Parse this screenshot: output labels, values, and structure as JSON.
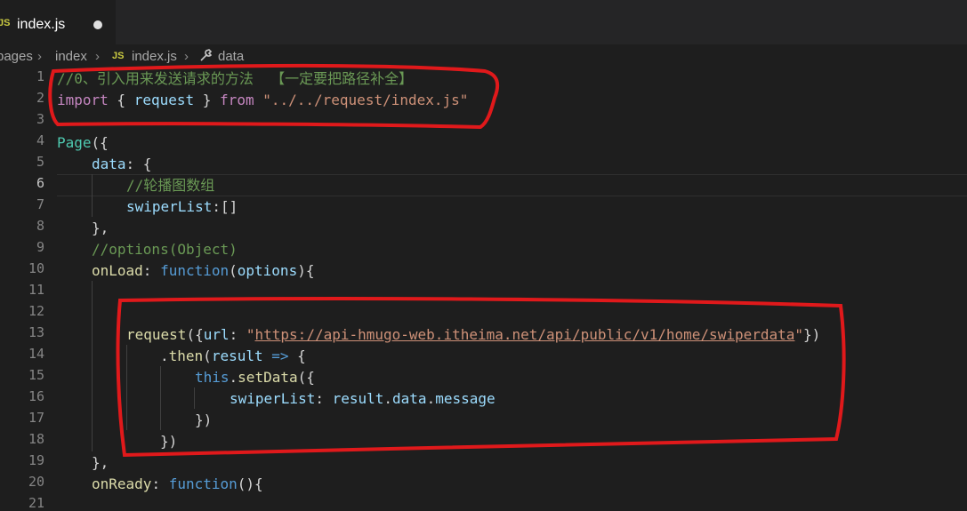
{
  "tab": {
    "file_icon": "JS",
    "filename": "index.js"
  },
  "breadcrumb": {
    "items": [
      "pages",
      "index"
    ],
    "file_icon": "JS",
    "file": "index.js",
    "symbol_icon": "wrench-icon",
    "symbol": "data"
  },
  "editor": {
    "active_line": 6,
    "line_numbers": [
      "1",
      "2",
      "3",
      "4",
      "5",
      "6",
      "7",
      "8",
      "9",
      "10",
      "11",
      "12",
      "13",
      "14",
      "15",
      "16",
      "17",
      "18",
      "19",
      "20",
      "21"
    ],
    "lines": {
      "l1": {
        "comment": "//0、引入用来发送请求的方法  【一定要把路径补全】"
      },
      "l2": {
        "import": "import",
        "ob": " { ",
        "name": "request",
        "cb": " } ",
        "from": "from",
        "sp": " ",
        "path": "\"../../request/index.js\""
      },
      "l4": {
        "fn": "Page",
        "rest": "({"
      },
      "l5": {
        "key": "data",
        "rest": ": {"
      },
      "l6": {
        "comment": "//轮播图数组"
      },
      "l7": {
        "key": "swiperList",
        "rest": ":[]"
      },
      "l8": {
        "text": "},"
      },
      "l9": {
        "comment": "//options(Object)"
      },
      "l10": {
        "key": "onLoad",
        "colon": ": ",
        "kw": "function",
        "open": "(",
        "param": "options",
        "close": "){"
      },
      "l13": {
        "fn": "request",
        "open": "({",
        "key": "url",
        "colon": ": ",
        "q1": "\"",
        "url": "https://api-hmugo-web.itheima.net/api/public/v1/home/swiperdata",
        "q2": "\"",
        "close": "})"
      },
      "l14": {
        "dot": ".",
        "fn": "then",
        "open": "(",
        "param": "result",
        "arrow": " => ",
        "brace": "{"
      },
      "l15": {
        "this": "this",
        "dot": ".",
        "fn": "setData",
        "open": "({"
      },
      "l16": {
        "key": "swiperList",
        "colon": ": ",
        "obj": "result",
        "d1": ".",
        "p1": "data",
        "d2": ".",
        "p2": "message"
      },
      "l17": {
        "text": "})"
      },
      "l18": {
        "text": "})"
      },
      "l19": {
        "text": "},"
      },
      "l20": {
        "key": "onReady",
        "colon": ": ",
        "kw": "function",
        "rest": "(){"
      }
    }
  },
  "annotations": {
    "color": "#e0191b"
  }
}
